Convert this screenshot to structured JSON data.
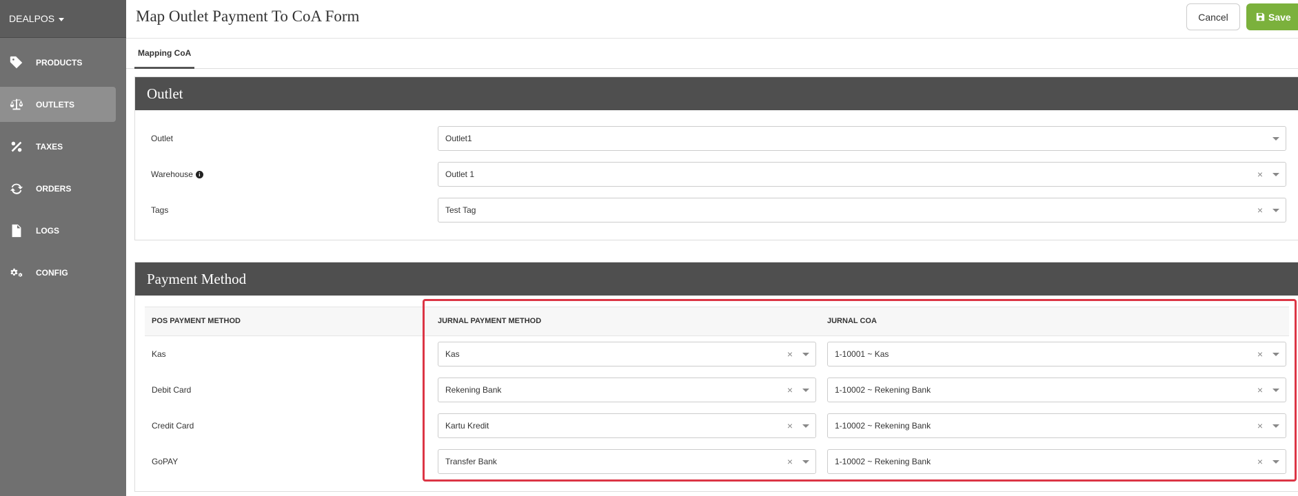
{
  "brand": "DEALPOS",
  "sidebar": {
    "items": [
      {
        "label": "PRODUCTS",
        "icon": "tag-icon"
      },
      {
        "label": "OUTLETS",
        "icon": "balance-scale-icon"
      },
      {
        "label": "TAXES",
        "icon": "percent-icon"
      },
      {
        "label": "ORDERS",
        "icon": "refresh-icon"
      },
      {
        "label": "LOGS",
        "icon": "code-file-icon"
      },
      {
        "label": "CONFIG",
        "icon": "cogs-icon"
      }
    ],
    "active": "OUTLETS"
  },
  "header": {
    "title": "Map Outlet Payment To CoA Form",
    "cancel_label": "Cancel",
    "save_label": "Save"
  },
  "tabs": [
    {
      "label": "Mapping CoA"
    }
  ],
  "outlet_section": {
    "title": "Outlet",
    "fields": [
      {
        "label": "Outlet",
        "value": "Outlet1",
        "clearable": false
      },
      {
        "label": "Warehouse",
        "value": "Outlet 1",
        "clearable": true,
        "info": "i"
      },
      {
        "label": "Tags",
        "value": "Test Tag",
        "clearable": true
      }
    ]
  },
  "payment_section": {
    "title": "Payment Method",
    "columns": [
      "POS PAYMENT METHOD",
      "JURNAL PAYMENT METHOD",
      "JURNAL COA"
    ],
    "rows": [
      {
        "pos": "Kas",
        "jurnal_method": "Kas",
        "jurnal_coa": "1-10001 ~ Kas"
      },
      {
        "pos": "Debit Card",
        "jurnal_method": "Rekening Bank",
        "jurnal_coa": "1-10002 ~ Rekening Bank"
      },
      {
        "pos": "Credit Card",
        "jurnal_method": "Kartu Kredit",
        "jurnal_coa": "1-10002 ~ Rekening Bank"
      },
      {
        "pos": "GoPAY",
        "jurnal_method": "Transfer Bank",
        "jurnal_coa": "1-10002 ~ Rekening Bank"
      }
    ],
    "clear_glyph": "×"
  },
  "colors": {
    "sidebar": "#707070",
    "save": "#7bb13c",
    "panel_head": "#4f4f4f",
    "highlight": "#dc3545"
  }
}
